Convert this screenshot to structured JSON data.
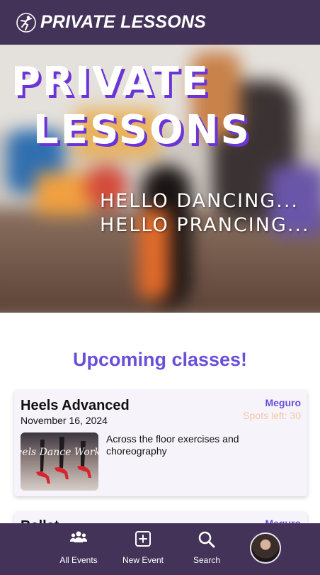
{
  "header": {
    "title": "PRIVATE LESSONS",
    "logo_icon": "dancer-logo-icon"
  },
  "hero": {
    "title_line1": "PRIVATE",
    "title_line2": "LESSONS",
    "tagline_line1": "HELLO DANCING...",
    "tagline_line2": "HELLO PRANCING..."
  },
  "section": {
    "heading": "Upcoming classes!"
  },
  "events": [
    {
      "name": "Heels Advanced",
      "date": "November 16, 2024",
      "location": "Meguro",
      "spots": "Spots left: 30",
      "image_caption": "eels Dance Worksho",
      "description": "Across the floor exercises and choreography"
    },
    {
      "name": "Ballet",
      "location": "Meguro"
    }
  ],
  "nav": {
    "all_events": "All Events",
    "new_event": "New Event",
    "search": "Search"
  },
  "colors": {
    "brand": "#443358",
    "accent": "#6a4fdb",
    "spots": "#f3c7a8"
  }
}
